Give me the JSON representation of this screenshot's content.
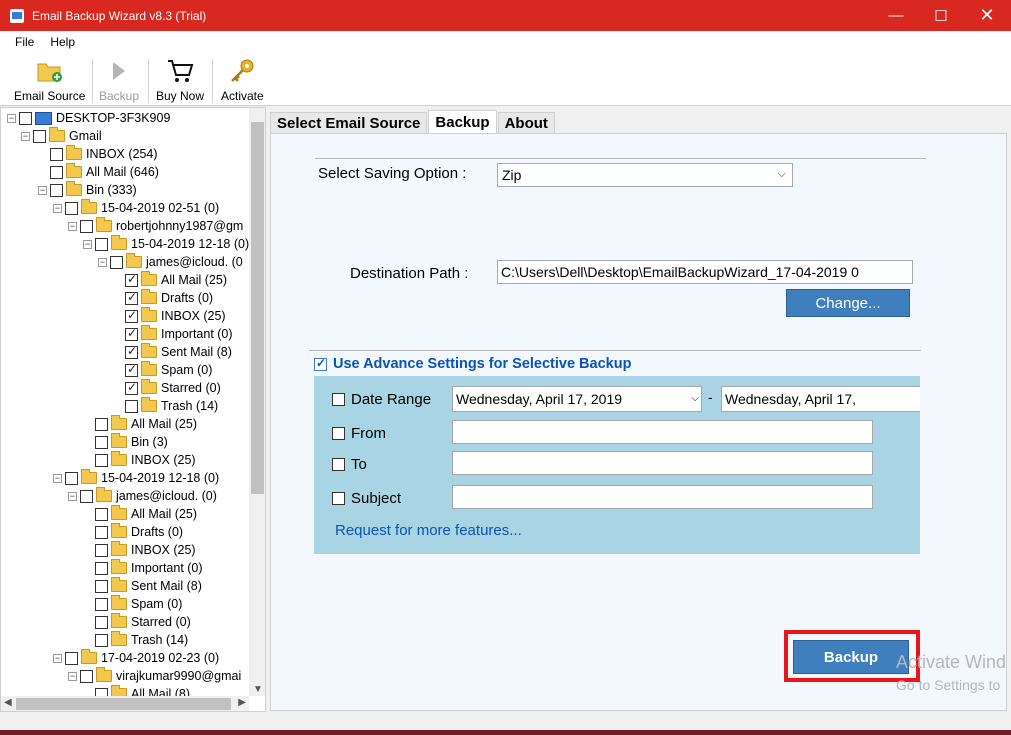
{
  "window": {
    "title": "Email Backup Wizard v8.3 (Trial)",
    "controls": {
      "minimize": "—",
      "maximize": "☐",
      "close": "✕"
    }
  },
  "menu": [
    "File",
    "Help"
  ],
  "toolbar": {
    "email_source": "Email Source",
    "backup": "Backup",
    "buy_now": "Buy Now",
    "activate": "Activate"
  },
  "tree": [
    {
      "label": "DESKTOP-3F3K909",
      "icon": "computer",
      "checked": false,
      "expander": "−"
    },
    {
      "label": "Gmail",
      "icon": "folder",
      "checked": false,
      "expander": "−"
    },
    {
      "label": "INBOX (254)",
      "icon": "folder",
      "checked": false,
      "expander": ""
    },
    {
      "label": "All Mail (646)",
      "icon": "folder",
      "checked": false,
      "expander": ""
    },
    {
      "label": "Bin (333)",
      "icon": "folder",
      "checked": false,
      "expander": "−"
    },
    {
      "label": "15-04-2019 02-51 (0)",
      "icon": "folder",
      "checked": false,
      "expander": "−"
    },
    {
      "label": "robertjohnny1987@gm",
      "icon": "folder",
      "checked": false,
      "expander": "−"
    },
    {
      "label": "15-04-2019 12-18 (0)",
      "icon": "folder",
      "checked": false,
      "expander": "−"
    },
    {
      "label": "james@icloud. (0",
      "icon": "folder",
      "checked": false,
      "expander": "−"
    },
    {
      "label": "All Mail (25)",
      "icon": "folder",
      "checked": true,
      "expander": ""
    },
    {
      "label": "Drafts (0)",
      "icon": "folder",
      "checked": true,
      "expander": ""
    },
    {
      "label": "INBOX (25)",
      "icon": "folder",
      "checked": true,
      "expander": ""
    },
    {
      "label": "Important (0)",
      "icon": "folder",
      "checked": true,
      "expander": ""
    },
    {
      "label": "Sent Mail (8)",
      "icon": "folder",
      "checked": true,
      "expander": ""
    },
    {
      "label": "Spam (0)",
      "icon": "folder",
      "checked": true,
      "expander": ""
    },
    {
      "label": "Starred (0)",
      "icon": "folder",
      "checked": true,
      "expander": ""
    },
    {
      "label": "Trash (14)",
      "icon": "folder",
      "checked": false,
      "expander": ""
    },
    {
      "label": "All Mail (25)",
      "icon": "folder",
      "checked": false,
      "expander": ""
    },
    {
      "label": "Bin (3)",
      "icon": "folder",
      "checked": false,
      "expander": ""
    },
    {
      "label": "INBOX (25)",
      "icon": "folder",
      "checked": false,
      "expander": ""
    },
    {
      "label": "15-04-2019 12-18 (0)",
      "icon": "folder",
      "checked": false,
      "expander": "−"
    },
    {
      "label": "james@icloud. (0)",
      "icon": "folder",
      "checked": false,
      "expander": "−"
    },
    {
      "label": "All Mail (25)",
      "icon": "folder",
      "checked": false,
      "expander": ""
    },
    {
      "label": "Drafts (0)",
      "icon": "folder",
      "checked": false,
      "expander": ""
    },
    {
      "label": "INBOX (25)",
      "icon": "folder",
      "checked": false,
      "expander": ""
    },
    {
      "label": "Important (0)",
      "icon": "folder",
      "checked": false,
      "expander": ""
    },
    {
      "label": "Sent Mail (8)",
      "icon": "folder",
      "checked": false,
      "expander": ""
    },
    {
      "label": "Spam (0)",
      "icon": "folder",
      "checked": false,
      "expander": ""
    },
    {
      "label": "Starred (0)",
      "icon": "folder",
      "checked": false,
      "expander": ""
    },
    {
      "label": "Trash (14)",
      "icon": "folder",
      "checked": false,
      "expander": ""
    },
    {
      "label": "17-04-2019 02-23 (0)",
      "icon": "folder",
      "checked": false,
      "expander": "−"
    },
    {
      "label": "virajkumar9990@gmai",
      "icon": "folder",
      "checked": false,
      "expander": "−"
    },
    {
      "label": "All Mail (8)",
      "icon": "folder",
      "checked": false,
      "expander": ""
    }
  ],
  "tabs": [
    "Select Email Source",
    "Backup",
    "About"
  ],
  "backup_form": {
    "saving_option_label": "Select Saving Option :",
    "saving_option_value": "Zip",
    "destination_label": "Destination Path :",
    "destination_value": "C:\\Users\\Dell\\Desktop\\EmailBackupWizard_17-04-2019 0",
    "change_button": "Change...",
    "advance_settings_label": "Use Advance Settings for Selective Backup",
    "date_range_label": "Date Range",
    "date_from": "Wednesday,      April      17, 2019",
    "date_separator": "-",
    "date_to": "Wednesday,      April      17,",
    "from_label": "From",
    "to_label": "To",
    "subject_label": "Subject",
    "request_link": "Request for more features...",
    "backup_button": "Backup"
  },
  "watermark": {
    "line1": "Activate Wind",
    "line2": "Go to Settings to"
  },
  "colors": {
    "titlebar": "#d9281f",
    "accent_button": "#3f7fbd",
    "advanced_panel": "#a9d4e3",
    "highlight_frame": "#e8151b",
    "link": "#0b53b5"
  }
}
